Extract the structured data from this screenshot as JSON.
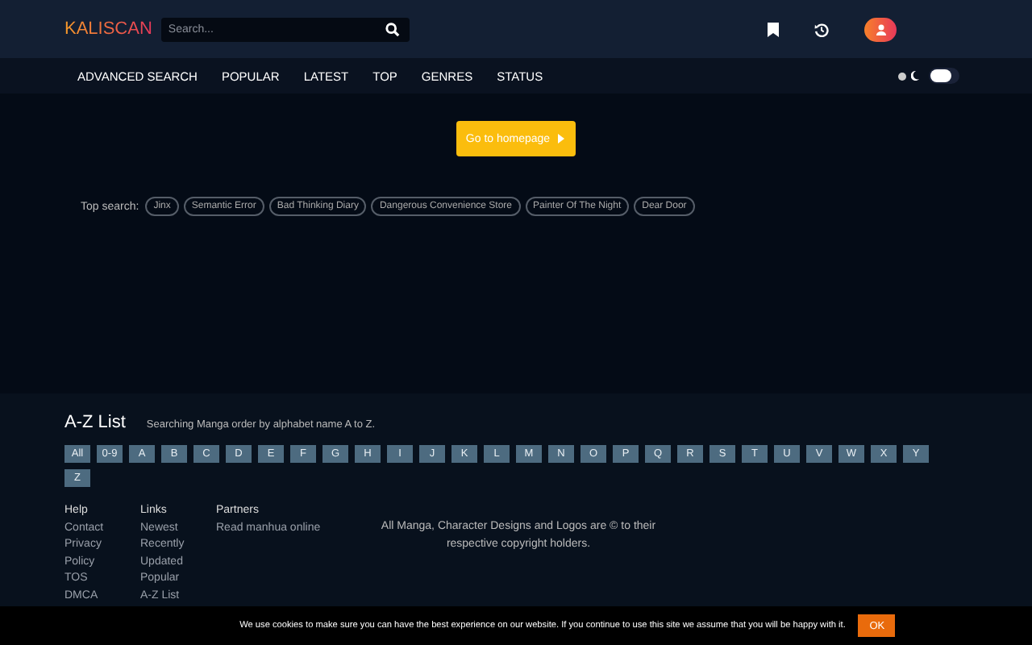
{
  "header": {
    "logo": "KALISCAN",
    "search": {
      "placeholder": "Search..."
    }
  },
  "nav": {
    "items": [
      "ADVANCED SEARCH",
      "POPULAR",
      "LATEST",
      "TOP",
      "GENRES",
      "STATUS"
    ],
    "dark_mode": {
      "on": true
    }
  },
  "main": {
    "homepage_button": "Go to homepage",
    "top_search": {
      "label": "Top search:",
      "tags": [
        "Jinx",
        "Semantic Error",
        "Bad Thinking Diary",
        "Dangerous Convenience Store",
        "Painter Of The Night",
        "Dear Door"
      ]
    }
  },
  "az_list": {
    "title": "A-Z List",
    "description": "Searching Manga order by alphabet name A to Z.",
    "letters": [
      "All",
      "0-9",
      "A",
      "B",
      "C",
      "D",
      "E",
      "F",
      "G",
      "H",
      "I",
      "J",
      "K",
      "L",
      "M",
      "N",
      "O",
      "P",
      "Q",
      "R",
      "S",
      "T",
      "U",
      "V",
      "W",
      "X",
      "Y",
      "Z"
    ]
  },
  "footer": {
    "columns": [
      {
        "heading": "Help",
        "links": [
          "Contact",
          "Privacy",
          "Policy",
          "TOS",
          "DMCA"
        ]
      },
      {
        "heading": "Links",
        "links": [
          "Newest",
          "Recently",
          "Updated",
          "Popular",
          "A-Z List"
        ]
      },
      {
        "heading": "Partners",
        "links": [
          "Read manhua online"
        ]
      }
    ],
    "copyright": "All Manga, Character Designs and Logos are © to their respective copyright holders."
  },
  "cookie_bar": {
    "message": "We use cookies to make sure you can have the best experience on our website. If you continue to use this site we assume that you will be happy with it.",
    "button": "OK"
  }
}
